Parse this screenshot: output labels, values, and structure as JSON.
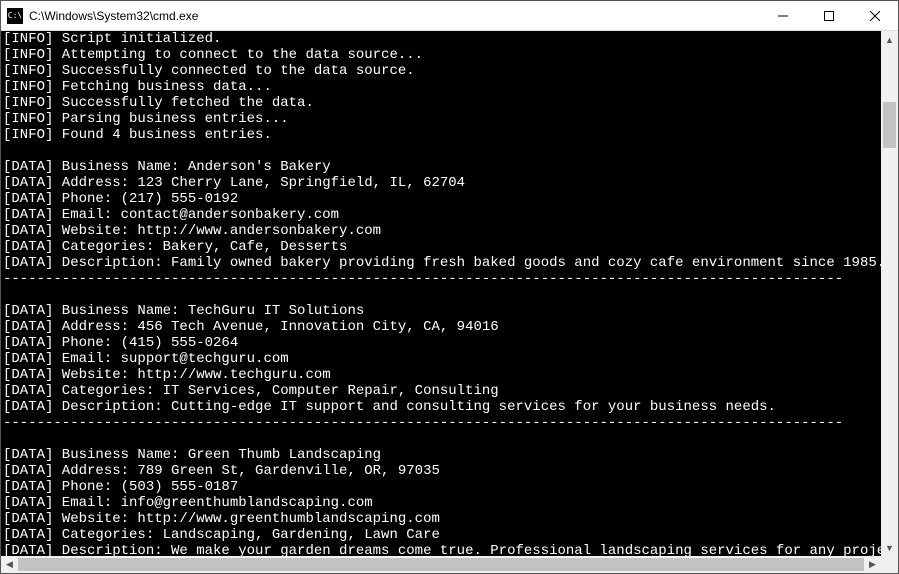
{
  "window": {
    "title": "C:\\Windows\\System32\\cmd.exe",
    "icon_text": "C:\\"
  },
  "log": {
    "info_tag": "[INFO]",
    "data_tag": "[DATA]",
    "separator": "----------------------------------------------------------------------------------------------------",
    "info_lines": [
      "Script initialized.",
      "Attempting to connect to the data source...",
      "Successfully connected to the data source.",
      "Fetching business data...",
      "Successfully fetched the data.",
      "Parsing business entries...",
      "Found 4 business entries."
    ],
    "businesses": [
      {
        "name_label": "Business Name:",
        "name": "Anderson's Bakery",
        "address_label": "Address:",
        "address": "123 Cherry Lane, Springfield, IL, 62704",
        "phone_label": "Phone:",
        "phone": "(217) 555-0192",
        "email_label": "Email:",
        "email": "contact@andersonbakery.com",
        "website_label": "Website:",
        "website": "http://www.andersonbakery.com",
        "categories_label": "Categories:",
        "categories": "Bakery, Cafe, Desserts",
        "description_label": "Description:",
        "description": "Family owned bakery providing fresh baked goods and cozy cafe environment since 1985."
      },
      {
        "name_label": "Business Name:",
        "name": "TechGuru IT Solutions",
        "address_label": "Address:",
        "address": "456 Tech Avenue, Innovation City, CA, 94016",
        "phone_label": "Phone:",
        "phone": "(415) 555-0264",
        "email_label": "Email:",
        "email": "support@techguru.com",
        "website_label": "Website:",
        "website": "http://www.techguru.com",
        "categories_label": "Categories:",
        "categories": "IT Services, Computer Repair, Consulting",
        "description_label": "Description:",
        "description": "Cutting-edge IT support and consulting services for your business needs."
      },
      {
        "name_label": "Business Name:",
        "name": "Green Thumb Landscaping",
        "address_label": "Address:",
        "address": "789 Green St, Gardenville, OR, 97035",
        "phone_label": "Phone:",
        "phone": "(503) 555-0187",
        "email_label": "Email:",
        "email": "info@greenthumblandscaping.com",
        "website_label": "Website:",
        "website": "http://www.greenthumblandscaping.com",
        "categories_label": "Categories:",
        "categories": "Landscaping, Gardening, Lawn Care",
        "description_label": "Description:",
        "description": "We make your garden dreams come true. Professional landscaping services for any project."
      }
    ]
  }
}
